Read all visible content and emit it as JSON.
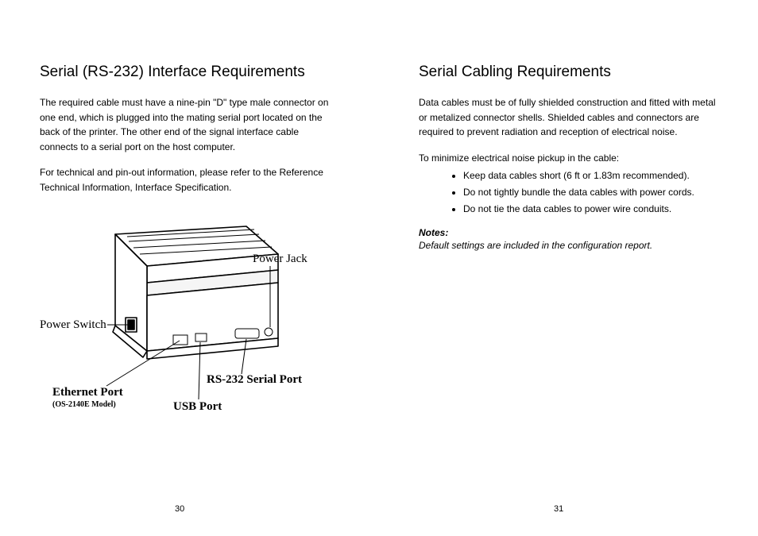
{
  "left": {
    "heading": "Serial (RS-232) Interface Requirements",
    "p1": "The required cable must have a nine-pin \"D\" type male connector on one end, which is plugged into the mating serial port located on the back of the printer. The other end of the signal interface cable connects to a serial port on the host computer.",
    "p2": "For technical and pin-out information, please refer to the Reference Technical Information, Interface Specification.",
    "diagram": {
      "power_switch": "Power Switch",
      "power_jack": "Power Jack",
      "rs232": "RS-232 Serial Port",
      "usb": "USB Port",
      "ethernet": "Ethernet Port",
      "ethernet_sub": "(OS-2140E Model)"
    },
    "page_number": "30"
  },
  "right": {
    "heading": "Serial Cabling Requirements",
    "p1": "Data cables must be of fully shielded construction and fitted with metal or metalized connector shells. Shielded cables and connectors are required to prevent radiation and reception of electrical noise.",
    "p2": "To minimize electrical noise pickup in the cable:",
    "bullets": [
      "Keep data cables short (6 ft or 1.83m recommended).",
      "Do not tightly bundle the data cables with power cords.",
      "Do not tie the data cables to power wire conduits."
    ],
    "notes_label": "Notes:",
    "notes_text": "Default settings are included in the configuration report.",
    "page_number": "31"
  }
}
